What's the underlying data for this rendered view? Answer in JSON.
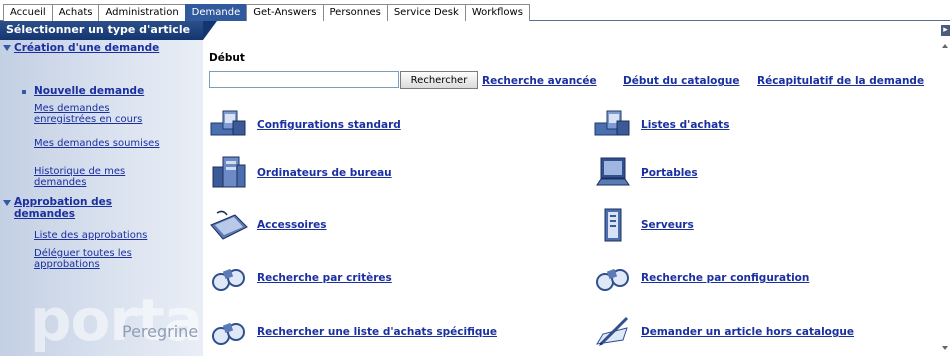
{
  "tabs": [
    {
      "label": "Accueil",
      "active": false
    },
    {
      "label": "Achats",
      "active": false
    },
    {
      "label": "Administration",
      "active": false
    },
    {
      "label": "Demande",
      "active": true
    },
    {
      "label": "Get-Answers",
      "active": false
    },
    {
      "label": "Personnes",
      "active": false
    },
    {
      "label": "Service Desk",
      "active": false
    },
    {
      "label": "Workflows",
      "active": false
    }
  ],
  "title": "Sélectionner un type d'article",
  "sidebar": {
    "group1": {
      "head": "Création d'une demande",
      "items": [
        "Nouvelle demande",
        "Mes demandes enregistrées en cours",
        "Mes demandes soumises",
        "Historique de mes demandes"
      ]
    },
    "group2": {
      "head": "Approbation des demandes",
      "items": [
        "Liste des approbations",
        "Déléguer toutes les approbations"
      ]
    },
    "logo": "portal",
    "brand": "Peregrine"
  },
  "main": {
    "breadcrumb": "Début",
    "search": {
      "value": "",
      "button": "Rechercher"
    },
    "links": {
      "advanced": "Recherche avancée",
      "catalog_start": "Début du catalogue",
      "summary": "Récapitulatif de la demande"
    },
    "categories": [
      {
        "label": "Configurations standard",
        "icon": "computer-configuration-icon"
      },
      {
        "label": "Listes d'achats",
        "icon": "computer-configuration-icon"
      },
      {
        "label": "Ordinateurs de bureau",
        "icon": "desktop-computer-icon"
      },
      {
        "label": "Portables",
        "icon": "laptop-icon"
      },
      {
        "label": "Accessoires",
        "icon": "keyboard-icon"
      },
      {
        "label": "Serveurs",
        "icon": "server-icon"
      },
      {
        "label": "Recherche par critères",
        "icon": "binoculars-icon"
      },
      {
        "label": "Recherche par configuration",
        "icon": "binoculars-icon"
      },
      {
        "label": "Rechercher une liste d'achats spécifique",
        "icon": "binoculars-icon"
      },
      {
        "label": "Demander un article hors catalogue",
        "icon": "pen-document-icon"
      }
    ]
  }
}
